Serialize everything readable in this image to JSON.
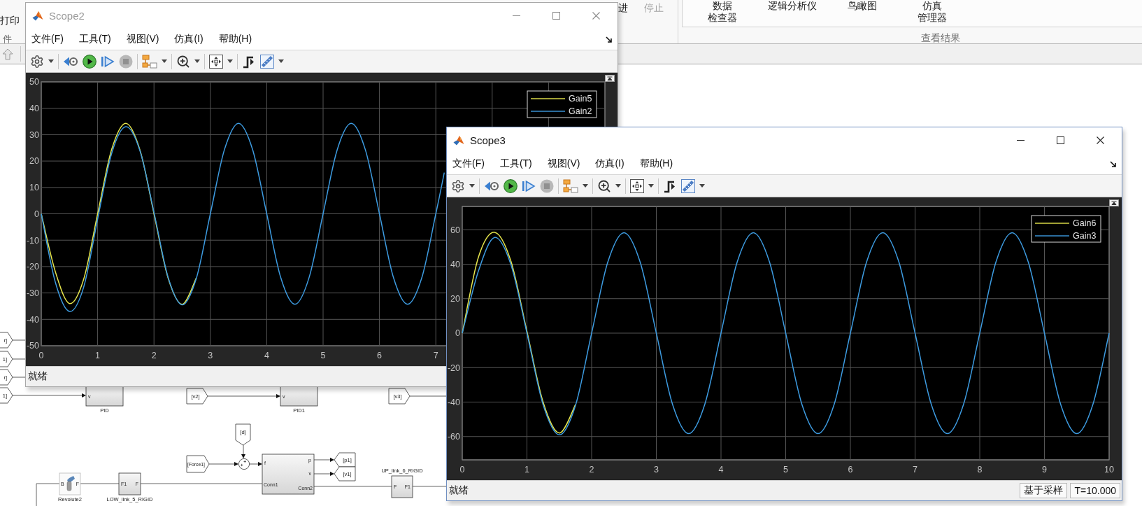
{
  "toolstrip": {
    "file_section": {
      "buttons": [
        {
          "label": "打印"
        }
      ],
      "section_label": "件"
    },
    "run_section": {
      "buttons": [
        {
          "label": "进",
          "disabled": false
        },
        {
          "label": "停止",
          "disabled": true
        }
      ]
    },
    "review_section": {
      "buttons": [
        {
          "lines": [
            "数据",
            "检查器"
          ]
        },
        {
          "lines": [
            "逻辑分析仪"
          ]
        },
        {
          "lines": [
            "鸟瞰图"
          ]
        },
        {
          "lines": [
            "仿真",
            "管理器"
          ]
        }
      ],
      "section_label": "查看结果"
    }
  },
  "diagram": {
    "blocks": [
      {
        "kind": "from",
        "label": "r]"
      },
      {
        "kind": "from",
        "label": "1]"
      },
      {
        "kind": "from",
        "label": "r]"
      },
      {
        "kind": "from",
        "label": "1]"
      },
      {
        "kind": "block",
        "label": "PID",
        "ports": [
          "v"
        ]
      },
      {
        "kind": "from",
        "label": "[v2]"
      },
      {
        "kind": "block",
        "label": "PID1",
        "ports": [
          "v"
        ]
      },
      {
        "kind": "from",
        "label": "[v3]"
      },
      {
        "kind": "from",
        "label": "[d]"
      },
      {
        "kind": "from",
        "label": "[Force1]"
      },
      {
        "kind": "sum"
      },
      {
        "kind": "subsystem",
        "ports": [
          "f",
          "p",
          "v",
          "Conn1",
          "Conn2"
        ]
      },
      {
        "kind": "goto",
        "label": "[p1]"
      },
      {
        "kind": "goto",
        "label": "[v1]"
      },
      {
        "kind": "joint",
        "label": "Revolute2",
        "ports": [
          "B",
          "F"
        ]
      },
      {
        "kind": "block",
        "label": "LOW_link_5_RIGID",
        "ports": [
          "F1",
          "F"
        ]
      },
      {
        "kind": "block",
        "label": "UP_link_6_RIGID",
        "ports": [
          "F",
          "F1"
        ]
      }
    ]
  },
  "scopes": [
    {
      "title": "Scope2",
      "active": false,
      "menus": [
        "文件(F)",
        "工具(T)",
        "视图(V)",
        "仿真(I)",
        "帮助(H)"
      ],
      "status": "就绪",
      "chart_data": {
        "type": "line",
        "grid": true,
        "legend": "upper right",
        "xlim": [
          0,
          10
        ],
        "ylim": [
          -50,
          50
        ],
        "xticks": [
          0,
          1,
          2,
          3,
          4,
          5,
          6,
          7
        ],
        "yticks": [
          -50,
          -40,
          -30,
          -20,
          -10,
          0,
          10,
          20,
          30,
          40,
          50
        ],
        "x": [
          0,
          0.25,
          0.5,
          0.75,
          1,
          1.25,
          1.5,
          1.75,
          2,
          2.25,
          2.5,
          2.75,
          3,
          3.25,
          3.5,
          3.75,
          4,
          4.25,
          4.5,
          4.75,
          5,
          5.25,
          5.5,
          5.75,
          6,
          6.25,
          6.5,
          6.75,
          7,
          7.15
        ],
        "series": [
          {
            "name": "Gain5",
            "color": "#e6e64c",
            "values": [
              0,
              -22,
              -34,
              -25,
              0,
              24.5,
              34.3,
              24.3,
              0,
              -24.3,
              -34.3,
              -24.3,
              null,
              null,
              null,
              null,
              null,
              null,
              null,
              null,
              null,
              null,
              null,
              null,
              null,
              null,
              null,
              null,
              null,
              null
            ]
          },
          {
            "name": "Gain2",
            "color": "#3d9be0",
            "values": [
              0,
              -26,
              -37,
              -28,
              -2,
              23,
              33,
              24,
              0.5,
              -24,
              -34.5,
              -24.5,
              0,
              24.3,
              34.3,
              24.3,
              0,
              -24.3,
              -34.3,
              -24.3,
              0,
              24.3,
              34.3,
              24.3,
              0,
              -24.3,
              -34.3,
              -24.3,
              0,
              15.6
            ]
          }
        ]
      }
    },
    {
      "title": "Scope3",
      "active": true,
      "menus": [
        "文件(F)",
        "工具(T)",
        "视图(V)",
        "仿真(I)",
        "帮助(H)"
      ],
      "status": "就绪",
      "status_fields": [
        "基于采样",
        "T=10.000"
      ],
      "chart_data": {
        "type": "line",
        "grid": true,
        "legend": "upper right",
        "xlim": [
          0,
          10
        ],
        "ylim": [
          -73.5,
          73.5
        ],
        "xticks": [
          0,
          1,
          2,
          3,
          4,
          5,
          6,
          7,
          8,
          9,
          10
        ],
        "yticks": [
          -60,
          -40,
          -20,
          0,
          20,
          40,
          60
        ],
        "x": [
          0,
          0.25,
          0.5,
          0.75,
          1,
          1.25,
          1.5,
          1.75,
          2,
          2.25,
          2.5,
          2.75,
          3,
          3.25,
          3.5,
          3.75,
          4,
          4.25,
          4.5,
          4.75,
          5,
          5.25,
          5.5,
          5.75,
          6,
          6.25,
          6.5,
          6.75,
          7,
          7.25,
          7.5,
          7.75,
          8,
          8.25,
          8.5,
          8.75,
          9,
          9.25,
          9.5,
          9.75,
          10
        ],
        "series": [
          {
            "name": "Gain6",
            "color": "#e6e64c",
            "values": [
              0,
              44,
              58.5,
              42,
              1,
              -40,
              -58,
              -41.5,
              null,
              null,
              null,
              null,
              null,
              null,
              null,
              null,
              null,
              null,
              null,
              null,
              null,
              null,
              null,
              null,
              null,
              null,
              null,
              null,
              null,
              null,
              null,
              null,
              null,
              null,
              null,
              null,
              null,
              null,
              null,
              null,
              null
            ]
          },
          {
            "name": "Gain3",
            "color": "#3d9be0",
            "values": [
              0,
              36,
              55.5,
              40,
              0,
              -41.5,
              -59,
              -42,
              0,
              41.2,
              58.3,
              41.2,
              0,
              -41.2,
              -58.3,
              -41.2,
              0,
              41.2,
              58.3,
              41.2,
              0,
              -41.2,
              -58.3,
              -41.2,
              0,
              41.2,
              58.3,
              41.2,
              0,
              -41.2,
              -58.3,
              -41.2,
              0,
              41.2,
              58.3,
              41.2,
              0,
              -41.2,
              -58.3,
              -41.2,
              0
            ]
          }
        ]
      }
    }
  ]
}
